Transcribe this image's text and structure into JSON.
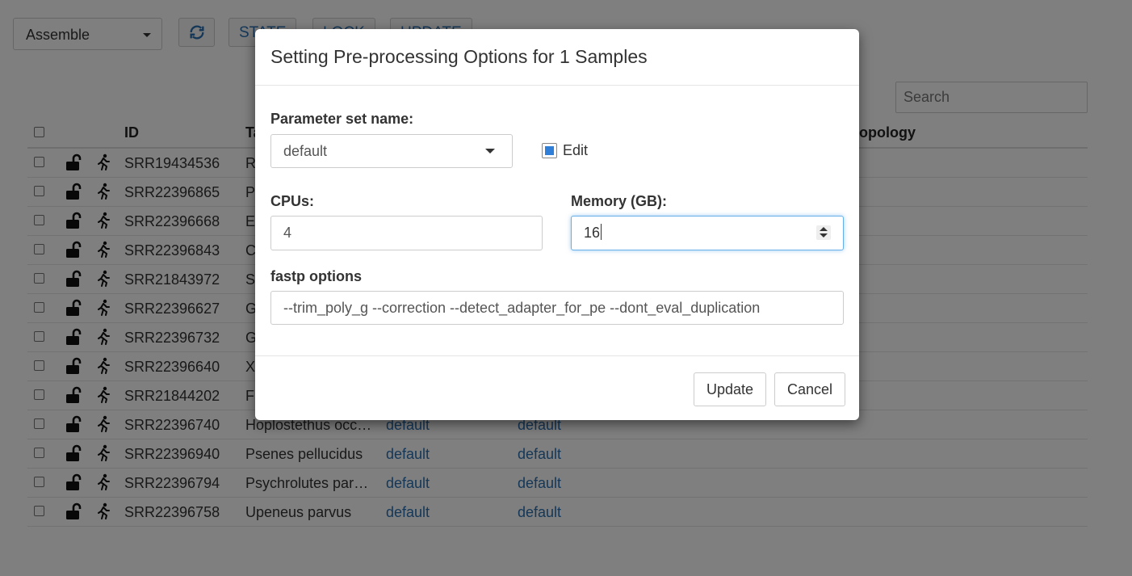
{
  "toolbar": {
    "mode_select": "Assemble",
    "refresh_icon": "refresh-icon",
    "buttons": [
      "STATE",
      "LOCK",
      "UPDATE"
    ]
  },
  "search": {
    "placeholder": "Search"
  },
  "table": {
    "headers": {
      "id": "ID",
      "taxon": "Ta",
      "topology": "opology"
    },
    "rows": [
      {
        "id": "SRR19434536",
        "taxon": "R",
        "param1": "",
        "param2": ""
      },
      {
        "id": "SRR22396865",
        "taxon": "P",
        "param1": "",
        "param2": ""
      },
      {
        "id": "SRR22396668",
        "taxon": "E",
        "param1": "",
        "param2": ""
      },
      {
        "id": "SRR22396843",
        "taxon": "C",
        "param1": "",
        "param2": ""
      },
      {
        "id": "SRR21843972",
        "taxon": "S",
        "param1": "",
        "param2": ""
      },
      {
        "id": "SRR22396627",
        "taxon": "G",
        "param1": "",
        "param2": ""
      },
      {
        "id": "SRR22396732",
        "taxon": "G",
        "param1": "",
        "param2": ""
      },
      {
        "id": "SRR22396640",
        "taxon": "X",
        "param1": "",
        "param2": ""
      },
      {
        "id": "SRR21844202",
        "taxon": "F",
        "param1": "",
        "param2": ""
      },
      {
        "id": "SRR22396740",
        "taxon": "Hoplostethus occi…",
        "param1": "default",
        "param2": "default"
      },
      {
        "id": "SRR22396940",
        "taxon": "Psenes pellucidus",
        "param1": "default",
        "param2": "default"
      },
      {
        "id": "SRR22396794",
        "taxon": "Psychrolutes para…",
        "param1": "default",
        "param2": "default"
      },
      {
        "id": "SRR22396758",
        "taxon": "Upeneus parvus",
        "param1": "default",
        "param2": "default"
      }
    ]
  },
  "modal": {
    "title": "Setting Pre-processing Options for 1 Samples",
    "param_set_label": "Parameter set name:",
    "param_set_value": "default",
    "edit_label": "Edit",
    "edit_checked": true,
    "cpus_label": "CPUs:",
    "cpus_value": "4",
    "memory_label": "Memory (GB):",
    "memory_value": "16",
    "fastp_label": "fastp options",
    "fastp_value": "--trim_poly_g --correction --detect_adapter_for_pe --dont_eval_duplication",
    "update_label": "Update",
    "cancel_label": "Cancel"
  },
  "colors": {
    "accent": "#2a6fb0",
    "checkbox_fill": "#2f7ed8",
    "focus_border": "#66afe9"
  }
}
